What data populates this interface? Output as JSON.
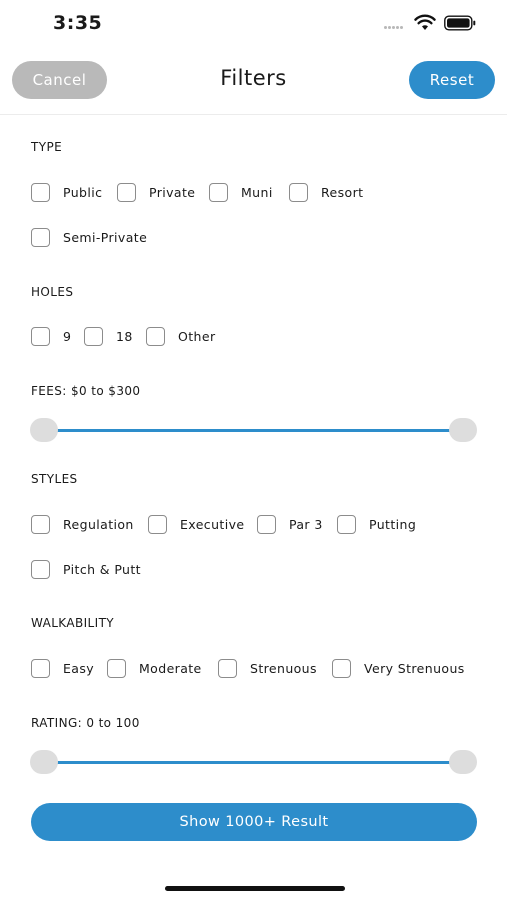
{
  "status_bar": {
    "time": "3:35"
  },
  "header": {
    "cancel_label": "Cancel",
    "title": "Filters",
    "reset_label": "Reset"
  },
  "sections": {
    "type": {
      "heading": "TYPE",
      "options": [
        "Public",
        "Private",
        "Muni",
        "Resort",
        "Semi-Private"
      ]
    },
    "holes": {
      "heading": "HOLES",
      "options": [
        "9",
        "18",
        "Other"
      ]
    },
    "fees": {
      "heading": "FEES: $0 to $300",
      "min": 0,
      "max": 300,
      "selected_min": 0,
      "selected_max": 300
    },
    "styles": {
      "heading": "STYLES",
      "options": [
        "Regulation",
        "Executive",
        "Par 3",
        "Putting",
        "Pitch & Putt"
      ]
    },
    "walkability": {
      "heading": "WALKABILITY",
      "options": [
        "Easy",
        "Moderate",
        "Strenuous",
        "Very Strenuous"
      ]
    },
    "rating": {
      "heading": "RATING: 0 to 100",
      "min": 0,
      "max": 100,
      "selected_min": 0,
      "selected_max": 100
    }
  },
  "show_results_label": "Show 1000+ Result",
  "colors": {
    "accent": "#2d8dcb",
    "cancel_bg": "#b9b9b9",
    "thumb": "#dddddd"
  }
}
